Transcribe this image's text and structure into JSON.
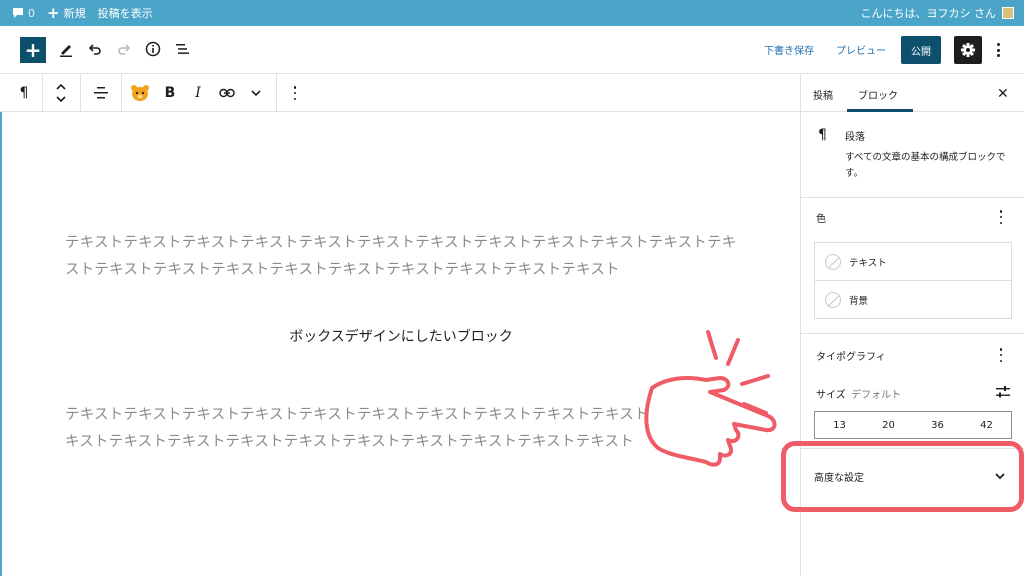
{
  "admin_bar": {
    "comments_count": "0",
    "new_label": "新規",
    "view_post_label": "投稿を表示",
    "greeting": "こんにちは、ヨフカシ さん"
  },
  "header": {
    "draft_label": "下書き保存",
    "preview_label": "プレビュー",
    "publish_label": "公開"
  },
  "block_toolbar": {
    "paragraph_icon": "¶",
    "bold": "B",
    "italic": "I"
  },
  "content": {
    "paragraph_1": "テキストテキストテキストテキストテキストテキストテキストテキストテキストテキストテキストテキストテキストテキストテキストテキストテキストテキストテキストテキストテキスト",
    "paragraph_2": "ボックスデザインにしたいブロック",
    "paragraph_3": "テキストテキストテキストテキストテキストテキストテキストテキストテキストテキストテキストテキストテキストテキストテキストテキストテキストテキストテキストテキスト"
  },
  "sidebar": {
    "tab_post": "投稿",
    "tab_block": "ブロック",
    "close": "✕",
    "block_icon": "¶",
    "block_title": "段落",
    "block_description": "すべての文章の基本の構成ブロックです。",
    "color_panel_title": "色",
    "color_text": "テキスト",
    "color_background": "背景",
    "typography_title": "タイポグラフィ",
    "size_label": "サイズ",
    "size_default": "デフォルト",
    "font_sizes": [
      "13",
      "20",
      "36",
      "42"
    ],
    "advanced_title": "高度な設定"
  },
  "colors": {
    "admin_bar": "#4aa5c9",
    "primary": "#0e4f6e",
    "highlight": "#ef5b66"
  }
}
